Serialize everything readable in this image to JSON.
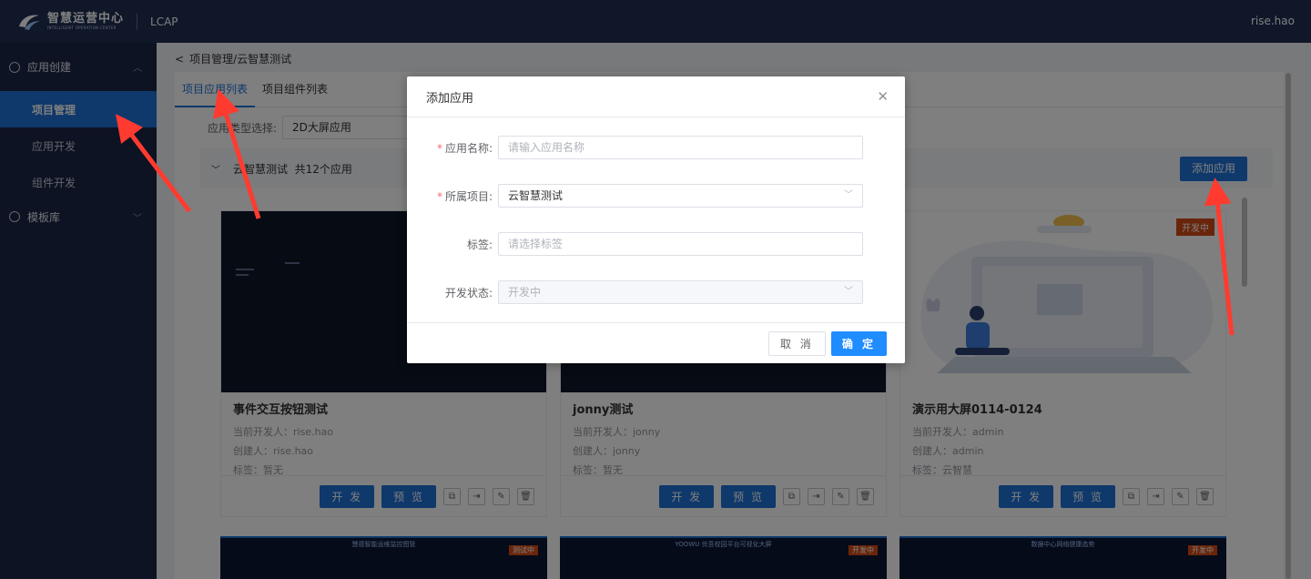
{
  "header": {
    "logo_cn": "智慧运营中心",
    "logo_en": "INTELLIGENT OPERATION CENTER",
    "app_name": "LCAP",
    "user": "rise.hao"
  },
  "sidebar": {
    "groups": [
      {
        "label": "应用创建",
        "items": [
          {
            "label": "项目管理",
            "active": true
          },
          {
            "label": "应用开发"
          },
          {
            "label": "组件开发"
          }
        ]
      },
      {
        "label": "模板库",
        "items": []
      }
    ]
  },
  "breadcrumb": "项目管理/云智慧测试",
  "tabs": [
    {
      "label": "项目应用列表",
      "active": true
    },
    {
      "label": "项目组件列表"
    }
  ],
  "filter": {
    "label": "应用类型选择:",
    "value": "2D大屏应用"
  },
  "group": {
    "name": "云智慧测试",
    "count_text": "共12个应用",
    "add_button": "添加应用"
  },
  "cards": [
    {
      "title": "事件交互按钮测试",
      "developer": "当前开发人：rise.hao",
      "creator": "创建人：rise.hao",
      "tag": "标签：暂无",
      "badge": ""
    },
    {
      "title": "jonny测试",
      "developer": "当前开发人：jonny",
      "creator": "创建人：jonny",
      "tag": "标签：暂无",
      "badge": ""
    },
    {
      "title": "演示用大屏0114-0124",
      "developer": "当前开发人：admin",
      "creator": "创建人：admin",
      "tag": "标签：云智慧",
      "badge": "开发中"
    }
  ],
  "card_buttons": {
    "develop": "开 发",
    "preview": "预 览"
  },
  "peek_cards": [
    {
      "label": "慧德智能运维监控图管",
      "tag": "测试中"
    },
    {
      "label": "YOOWU 优吾校园平台可视化大屏",
      "tag": "开发中"
    },
    {
      "label": "数据中心网络健康态势",
      "tag": "开发中"
    }
  ],
  "dialog": {
    "title": "添加应用",
    "fields": [
      {
        "label": "应用名称:",
        "required": true,
        "placeholder": "请输入应用名称",
        "value": ""
      },
      {
        "label": "所属项目:",
        "required": true,
        "placeholder": "",
        "value": "云智慧测试"
      },
      {
        "label": "标签:",
        "required": false,
        "placeholder": "请选择标签",
        "value": ""
      },
      {
        "label": "开发状态:",
        "required": false,
        "placeholder": "",
        "value": "开发中"
      }
    ],
    "cancel": "取 消",
    "ok": "确 定"
  },
  "colors": {
    "primary": "#1f70d6",
    "sidebar": "#1b2744",
    "topbar": "#1e2f53",
    "annotation": "#ff3b30",
    "badge": "#d24b17"
  }
}
